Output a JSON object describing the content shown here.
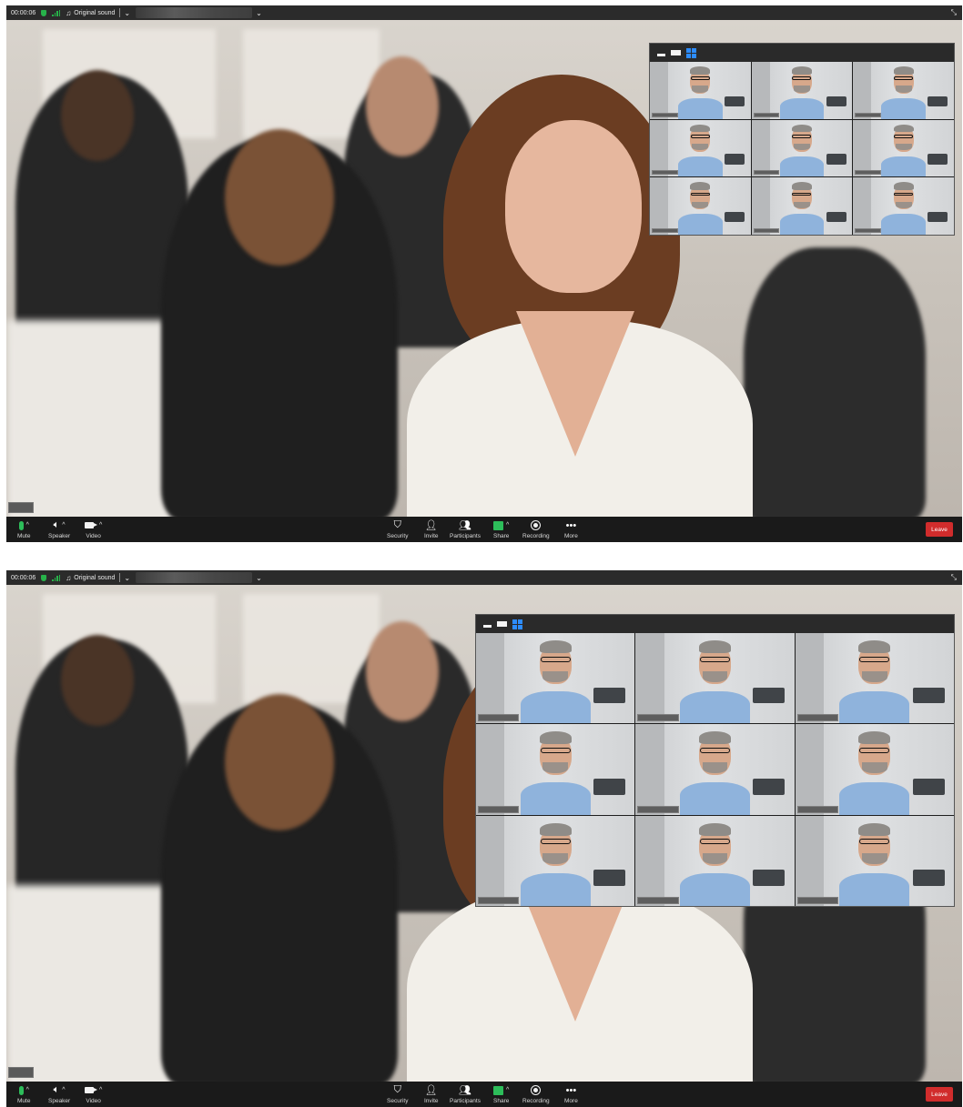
{
  "top_bar": {
    "timer": "00:00:06",
    "audio_mode": "Original sound"
  },
  "toolbar": {
    "mute": "Mute",
    "speaker": "Speaker",
    "video": "Video",
    "security": "Security",
    "invite": "Invite",
    "participants": "Participants",
    "share": "Share",
    "recording": "Recording",
    "more": "More",
    "leave": "Leave"
  },
  "gallery": {
    "view_modes": [
      "minimize",
      "speaker-strip",
      "gallery-grid"
    ],
    "active_view": "gallery-grid",
    "tile_count": 9
  },
  "colors": {
    "accent_blue": "#2d8cff",
    "mic_green": "#2dbd5a",
    "leave_red": "#d12c2c",
    "toolbar_bg": "#1a1a1a"
  }
}
